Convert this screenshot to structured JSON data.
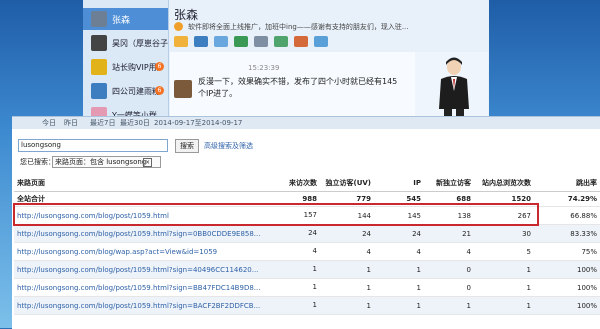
{
  "chat": {
    "contacts": [
      {
        "name": "张森",
        "active": true,
        "badge": "",
        "color": "#6d7f94"
      },
      {
        "name": "昊冈（厚崽谷子）",
        "active": false,
        "badge": "",
        "color": "#444444"
      },
      {
        "name": "站长购VIP用户",
        "active": false,
        "badge": "6",
        "color": "#e2b21a"
      },
      {
        "name": "四公司建雨粉",
        "active": false,
        "badge": "6",
        "color": "#3d7ec0"
      },
      {
        "name": "Y一蝶等小群",
        "active": false,
        "badge": "",
        "color": "#e39ab2"
      }
    ],
    "title": "张森",
    "subtitle": "软件即将全面上线推广，加班中ing——感谢有支持的朋友们，现入驻...",
    "time": "15:23:39",
    "message": "反漫一下，效果确实不错，发布了四个小时就已经有145个IP进了。"
  },
  "browser": {
    "date_prefix": "今日",
    "date_links": [
      "昨日",
      "最近7日",
      "最近30日"
    ],
    "date_range": "2014-09-17至2014-09-17",
    "search_value": "lusongsong",
    "search_button": "搜索",
    "advanced_link": "高级搜索及筛选",
    "searched_label": "您已搜索：",
    "chip_text": "来路页面：包含 lusongsong",
    "columns": [
      "来路页面",
      "来访次数",
      "独立访客(UV)",
      "IP",
      "新独立访客",
      "站内总浏览次数",
      "跳出率"
    ],
    "total_row": {
      "label": "全站合计",
      "values": [
        "988",
        "779",
        "545",
        "688",
        "1520",
        "74.29%"
      ]
    },
    "rows": [
      {
        "url": "http://lusongsong.com/blog/post/1059.html",
        "values": [
          "157",
          "144",
          "145",
          "138",
          "267",
          "66.88%"
        ]
      },
      {
        "url": "http://lusongsong.com/blog/post/1059.html?sign=0BB0CDDE9E858...",
        "values": [
          "24",
          "24",
          "24",
          "21",
          "30",
          "83.33%"
        ]
      },
      {
        "url": "http://lusongsong.com/blog/wap.asp?act=View&id=1059",
        "values": [
          "4",
          "4",
          "4",
          "4",
          "5",
          "75%"
        ]
      },
      {
        "url": "http://lusongsong.com/blog/post/1059.html?sign=40496CC114620...",
        "values": [
          "1",
          "1",
          "1",
          "0",
          "1",
          "100%"
        ]
      },
      {
        "url": "http://lusongsong.com/blog/post/1059.html?sign=BB47FDC14B9D8...",
        "values": [
          "1",
          "1",
          "1",
          "0",
          "1",
          "100%"
        ]
      },
      {
        "url": "http://lusongsong.com/blog/post/1059.html?sign=BACF2BF2DDFCB...",
        "values": [
          "1",
          "1",
          "1",
          "1",
          "1",
          "100%"
        ]
      }
    ]
  }
}
